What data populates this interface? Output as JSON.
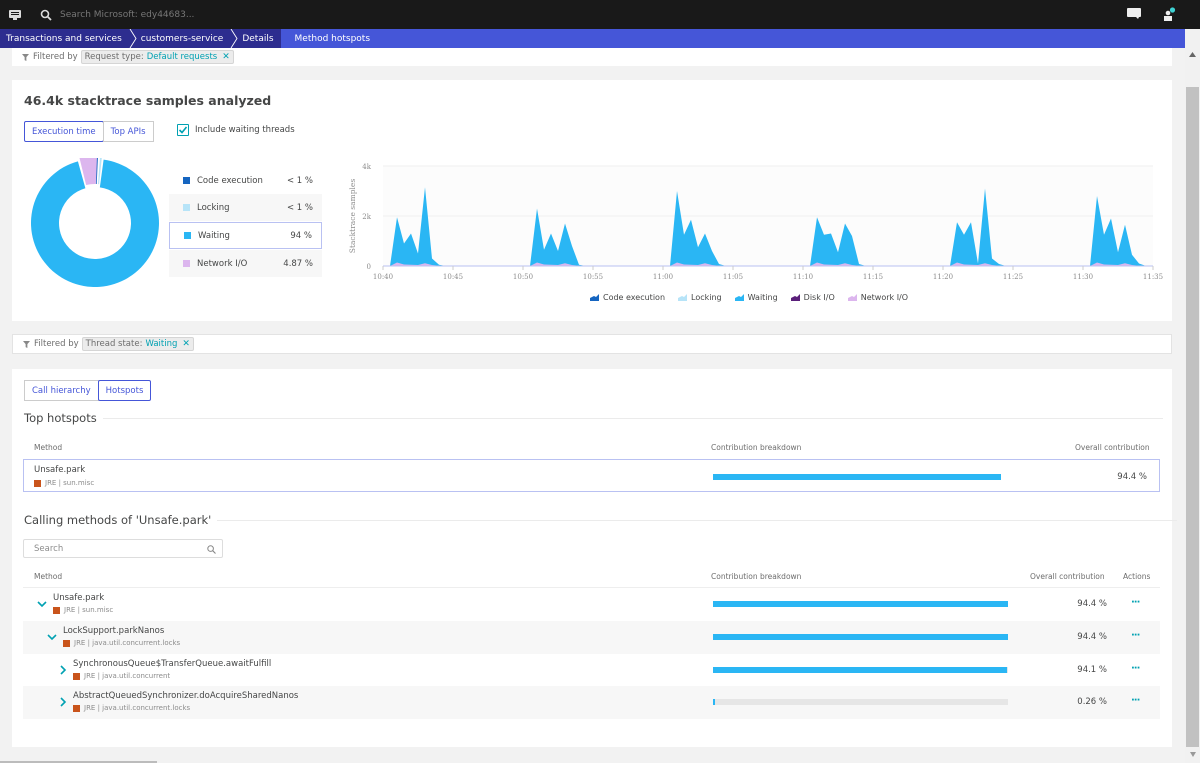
{
  "topbar": {
    "search_placeholder": "Search Microsoft: edy44683...",
    "icons": [
      "menu-icon",
      "search-icon",
      "chat-icon",
      "user-icon"
    ]
  },
  "breadcrumb": [
    "Transactions and services",
    "customers-service",
    "Details",
    "Method hotspots"
  ],
  "filter1": {
    "prefix": "Filtered by",
    "key": "Request type:",
    "value": "Default requests"
  },
  "summary": {
    "title": "46.4k stacktrace samples analyzed",
    "toggle": [
      "Execution time",
      "Top APIs"
    ],
    "selected_toggle": "Execution time",
    "checkbox_label": "Include waiting threads",
    "checkbox_checked": true,
    "breakdown": [
      {
        "label": "Code execution",
        "pct": "< 1 %",
        "color": "#1565c0"
      },
      {
        "label": "Locking",
        "pct": "< 1 %",
        "color": "#b7e4f8"
      },
      {
        "label": "Waiting",
        "pct": "94 %",
        "color": "#2ab6f4"
      },
      {
        "label": "Network I/O",
        "pct": "4.87 %",
        "color": "#dcb6ee"
      }
    ]
  },
  "chart_data": [
    {
      "type": "pie",
      "subtype": "donut",
      "labels": [
        "Code execution",
        "Locking",
        "Waiting",
        "Network I/O"
      ],
      "values": [
        0.6,
        0.5,
        94,
        4.87
      ],
      "colors": [
        "#1565c0",
        "#b7e4f8",
        "#2ab6f4",
        "#dcb6ee"
      ]
    },
    {
      "type": "area",
      "stacked": true,
      "ylabel": "Stacktrace samples",
      "xlabel": "",
      "ylim": [
        0,
        4000
      ],
      "yticks": [
        "0",
        "2k",
        "4k"
      ],
      "xticks": [
        "10:40",
        "10:45",
        "10:50",
        "10:55",
        "11:00",
        "11:05",
        "11:10",
        "11:15",
        "11:20",
        "11:25",
        "11:30",
        "11:35"
      ],
      "x_range_minutes": [
        0,
        55
      ],
      "grid": true,
      "legend_position": "bottom",
      "legend": [
        "Code execution",
        "Locking",
        "Waiting",
        "Disk I/O",
        "Network I/O"
      ],
      "legend_colors": [
        "#1565c0",
        "#b7e4f8",
        "#2ab6f4",
        "#5a1f7a",
        "#dcb6ee"
      ],
      "bursts_minute_offsets": [
        0.5,
        10.5,
        20.5,
        30.5,
        40.5,
        50.5
      ],
      "burst_profiles": [
        [
          0,
          1950,
          900,
          1300,
          500,
          3150,
          300,
          50,
          0
        ],
        [
          0,
          2300,
          650,
          1300,
          600,
          1700,
          800,
          50,
          0
        ],
        [
          0,
          3000,
          1250,
          1850,
          750,
          1300,
          600,
          80,
          0
        ],
        [
          0,
          1950,
          1250,
          1300,
          550,
          1700,
          1200,
          80,
          0
        ],
        [
          0,
          1750,
          1250,
          1750,
          100,
          3100,
          300,
          80,
          0
        ],
        [
          0,
          2800,
          1250,
          1900,
          550,
          1650,
          450,
          100,
          0
        ]
      ],
      "network_io_profile": [
        0,
        140,
        60,
        50,
        40,
        110,
        40,
        10,
        0
      ]
    }
  ],
  "filter2": {
    "prefix": "Filtered by",
    "key": "Thread state:",
    "value": "Waiting"
  },
  "hotspots": {
    "tabs": [
      "Call hierarchy",
      "Hotspots"
    ],
    "selected_tab": "Hotspots",
    "top_title": "Top hotspots",
    "columns": {
      "method": "Method",
      "breakdown": "Contribution breakdown",
      "overall": "Overall contribution",
      "actions": "Actions"
    },
    "top": [
      {
        "name": "Unsafe.park",
        "sub": "JRE | sun.misc",
        "pct": "94.4 %",
        "fraction": 0.944
      }
    ],
    "calling_title": "Calling methods of 'Unsafe.park'",
    "search_placeholder": "Search",
    "calling": [
      {
        "name": "Unsafe.park",
        "sub": "JRE | sun.misc",
        "pct": "94.4 %",
        "fraction": 0.944,
        "expanded": true,
        "depth": 0,
        "actions": "···"
      },
      {
        "name": "LockSupport.parkNanos",
        "sub": "JRE | java.util.concurrent.locks",
        "pct": "94.4 %",
        "fraction": 0.944,
        "expanded": true,
        "depth": 1,
        "actions": "···"
      },
      {
        "name": "SynchronousQueue$TransferQueue.awaitFulfill",
        "sub": "JRE | java.util.concurrent",
        "pct": "94.1 %",
        "fraction": 0.941,
        "expanded": false,
        "depth": 2,
        "actions": "···"
      },
      {
        "name": "AbstractQueuedSynchronizer.doAcquireSharedNanos",
        "sub": "JRE | java.util.concurrent.locks",
        "pct": "0.26 %",
        "fraction": 0.0026,
        "expanded": false,
        "depth": 2,
        "actions": "···"
      }
    ]
  }
}
